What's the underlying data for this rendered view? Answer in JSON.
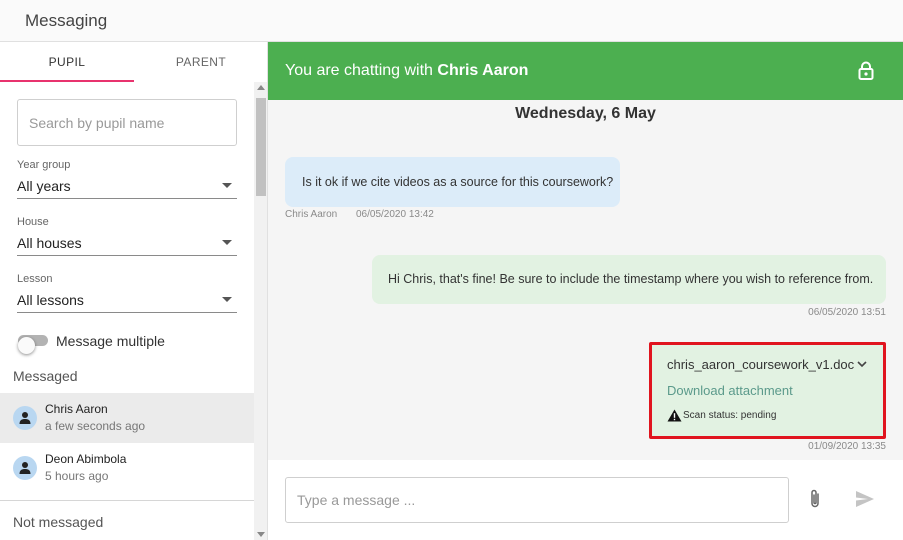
{
  "app": {
    "title": "Messaging"
  },
  "sidebar": {
    "tabs": [
      {
        "label": "PUPIL"
      },
      {
        "label": "PARENT"
      }
    ],
    "search": {
      "placeholder": "Search by pupil name",
      "value": ""
    },
    "filters": [
      {
        "label": "Year group",
        "value": "All years"
      },
      {
        "label": "House",
        "value": "All houses"
      },
      {
        "label": "Lesson",
        "value": "All lessons"
      }
    ],
    "toggle": {
      "label": "Message multiple",
      "on": false
    },
    "messaged_heading": "Messaged",
    "contacts": [
      {
        "name": "Chris Aaron",
        "time": "a few seconds ago",
        "active": true
      },
      {
        "name": "Deon Abimbola",
        "time": "5 hours ago",
        "active": false
      }
    ],
    "not_messaged_heading": "Not messaged"
  },
  "chat": {
    "header_prefix": "You are chatting with",
    "header_name": "Chris Aaron",
    "date": "Wednesday, 6 May",
    "messages": [
      {
        "direction": "in",
        "text": "Is it ok if we cite videos as a source for this coursework?",
        "sender": "Chris Aaron",
        "time": "06/05/2020 13:42"
      },
      {
        "direction": "out",
        "text": "Hi Chris, that's fine! Be sure to include the timestamp where you wish to reference from.",
        "time": "06/05/2020 13:51"
      }
    ],
    "attachment": {
      "file_name": "chris_aaron_coursework_v1.doc",
      "download_label": "Download attachment",
      "scan_status": "Scan status: pending",
      "time": "01/09/2020 13:35"
    },
    "composer": {
      "placeholder": "Type a message ...",
      "value": ""
    }
  },
  "colors": {
    "header_green": "#4caf50",
    "tab_accent": "#e8336e",
    "incoming_bubble": "#dcecf9",
    "outgoing_bubble": "#e2f2e2",
    "highlight_border": "#e0141e",
    "link": "#5b9a8b"
  },
  "icons": [
    "lock-icon",
    "person-icon",
    "chevron-down-icon",
    "warning-icon",
    "paperclip-icon",
    "send-icon"
  ]
}
